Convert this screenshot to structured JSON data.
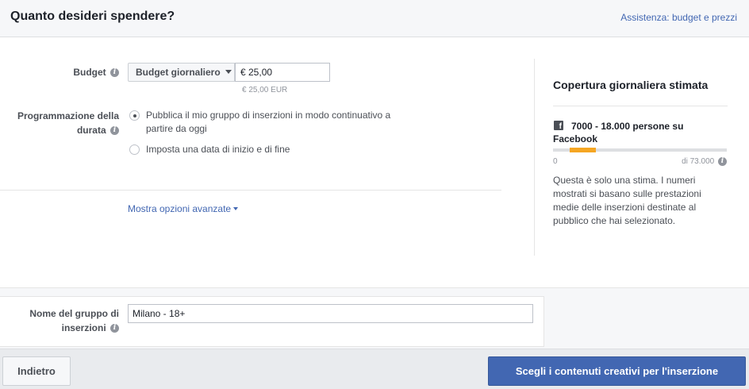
{
  "header": {
    "title": "Quanto desideri spendere?",
    "help_link": "Assistenza: budget e prezzi"
  },
  "budget": {
    "label": "Budget",
    "type_selected": "Budget giornaliero",
    "value": "€ 25,00",
    "sub_value": "€ 25,00 EUR"
  },
  "schedule": {
    "label_line1": "Programmazione della",
    "label_line2": "durata",
    "options": [
      {
        "label": "Pubblica il mio gruppo di inserzioni in modo continuativo a partire da oggi",
        "selected": true
      },
      {
        "label": "Imposta una data di inizio e di fine",
        "selected": false
      }
    ]
  },
  "advanced": {
    "label": "Mostra opzioni avanzate"
  },
  "reach": {
    "title": "Copertura giornaliera stimata",
    "platform_icon": "facebook-icon",
    "range_text": "7000 - 18.000 persone su Facebook",
    "scale_min": "0",
    "scale_max": "di 73.000",
    "estimate_low": 7000,
    "estimate_high": 18000,
    "scale_total": 73000,
    "disclaimer": "Questa è solo una stima. I numeri mostrati si basano sulle prestazioni medie delle inserzioni destinate al pubblico che hai selezionato."
  },
  "adset_name": {
    "label_line1": "Nome del gruppo di",
    "label_line2": "inserzioni",
    "value": "Milano - 18+"
  },
  "footer": {
    "back_label": "Indietro",
    "primary_label": "Scegli i contenuti creativi per l'inserzione"
  },
  "colors": {
    "accent": "#4267b2",
    "reach_fill": "#f5a623"
  }
}
